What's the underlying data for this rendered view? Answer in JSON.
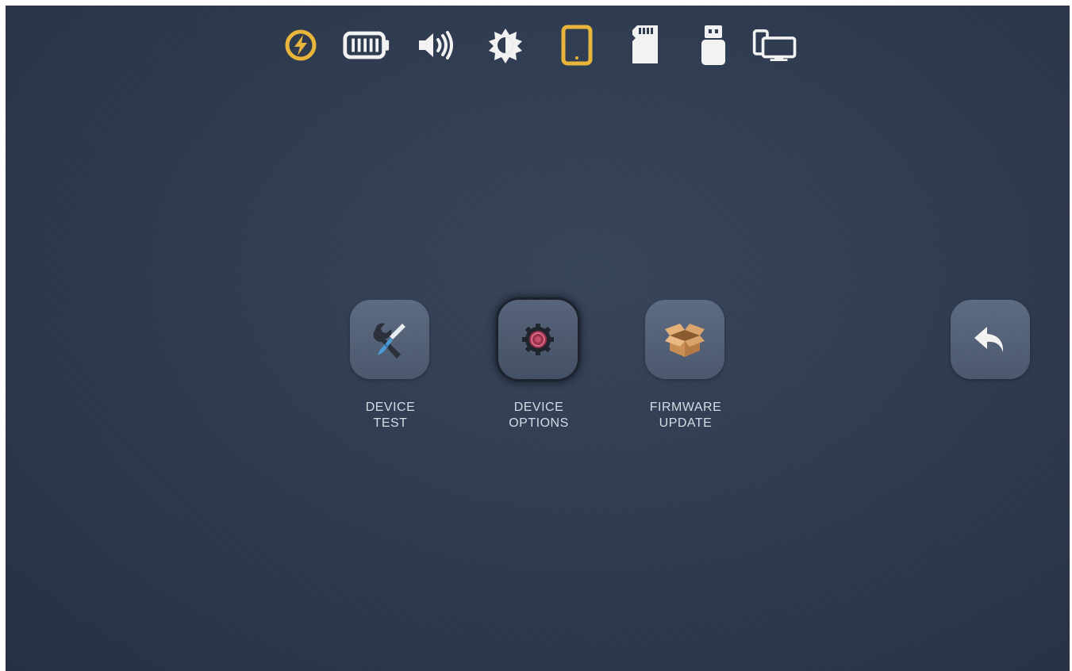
{
  "status_bar": {
    "icons": [
      "power-icon",
      "battery-icon",
      "volume-icon",
      "brightness-icon",
      "tablet-icon",
      "sd-card-icon",
      "usb-drive-icon",
      "screen-mirror-icon"
    ],
    "colors": {
      "active": "#e8b53a",
      "default": "#f2f2f2"
    }
  },
  "menu": {
    "items": [
      {
        "id": "device-test",
        "icon": "tools-icon",
        "label_line1": "DEVICE",
        "label_line2": "TEST"
      },
      {
        "id": "device-options",
        "icon": "gear-icon",
        "label_line1": "DEVICE",
        "label_line2": "OPTIONS",
        "selected": true
      },
      {
        "id": "firmware-update",
        "icon": "box-icon",
        "label_line1": "FIRMWARE",
        "label_line2": "UPDATE"
      }
    ]
  },
  "back": {
    "icon": "back-arrow-icon"
  },
  "colors": {
    "background": "#2f3b50",
    "tile": "#55627a",
    "label": "#d6dbe3"
  }
}
